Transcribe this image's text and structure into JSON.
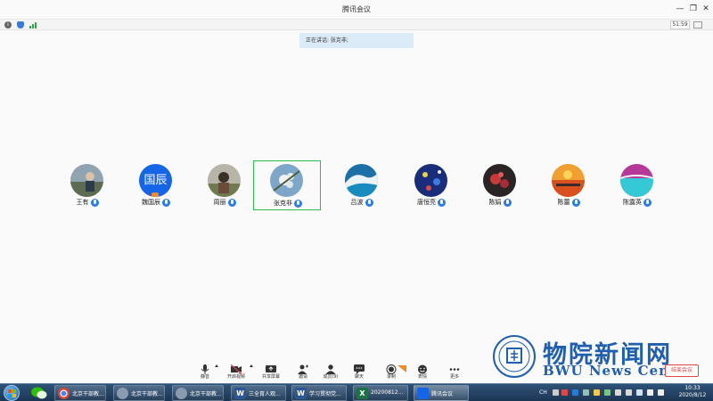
{
  "window": {
    "title": "腾讯会议"
  },
  "info_bar": {
    "timer": "51:59"
  },
  "speaking": {
    "text": "正在讲话: 张克非;"
  },
  "participants": [
    {
      "name": "王有",
      "active": false
    },
    {
      "name": "魏国辰",
      "avatar_text": "国辰",
      "active": false
    },
    {
      "name": "周丽",
      "active": false
    },
    {
      "name": "张克非",
      "active": true
    },
    {
      "name": "吕波",
      "active": false
    },
    {
      "name": "唐恒亮",
      "active": false
    },
    {
      "name": "陈娟",
      "active": false
    },
    {
      "name": "陈蕾",
      "active": false
    },
    {
      "name": "陈露英",
      "active": false
    }
  ],
  "toolbar": {
    "mute": "静音",
    "video": "开启视频",
    "share": "共享屏幕",
    "invite": "邀请",
    "members": "成员(9)",
    "chat": "聊天",
    "record": "录制",
    "reactions": "表情",
    "more": "更多",
    "end": "结束会议"
  },
  "watermark": {
    "title": "物院新闻网",
    "subtitle": "BWU News Center"
  },
  "taskbar": {
    "items": [
      "北京干部教...",
      "北京干部教...",
      "北京干部教...",
      "三全育人观...",
      "学习贯彻党...",
      "20200812...",
      "腾讯会议"
    ],
    "lang": "CH",
    "time": "10:33",
    "date": "2020/8/12"
  },
  "colors": {
    "accent_blue": "#2d7be5",
    "active_border": "#2fba4e",
    "watermark_blue": "#1f5fae",
    "end_red": "#e04848"
  }
}
